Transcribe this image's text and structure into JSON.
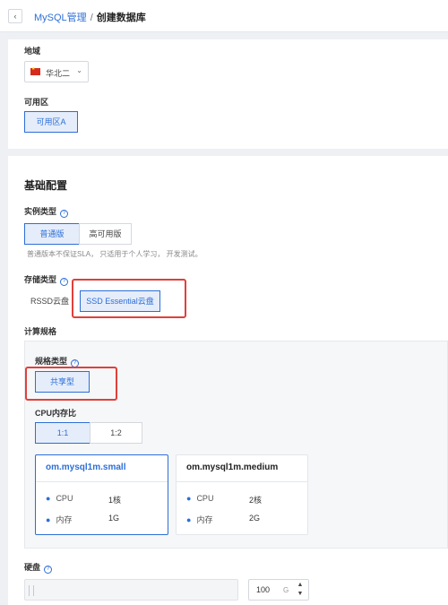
{
  "header": {
    "back_icon": "chevron-left-icon",
    "back_glyph": "‹",
    "breadcrumb_parent": "MySQL管理",
    "separator": "/",
    "breadcrumb_current": "创建数据库"
  },
  "location": {
    "region_label": "地域",
    "region_value": "华北二",
    "region_flag_icon": "china-flag-icon",
    "zone_label": "可用区",
    "zone_options": [
      "可用区A"
    ],
    "zone_selected": "可用区A"
  },
  "basic": {
    "title": "基础配置",
    "instance_type_label": "实例类型",
    "instance_types": [
      "普通版",
      "高可用版"
    ],
    "instance_selected": "普通版",
    "instance_hint": "普通版本不保证SLA， 只适用于个人学习， 开发测试。",
    "storage_type_label": "存储类型",
    "storage_types": [
      "RSSD云盘",
      "SSD Essential云盘"
    ],
    "storage_selected": "SSD Essential云盘",
    "compute_label": "计算规格",
    "spec_type_label": "规格类型",
    "spec_types": [
      "共享型"
    ],
    "spec_selected": "共享型",
    "ratio_label": "CPU内存比",
    "ratios": [
      "1:1",
      "1:2"
    ],
    "ratio_selected": "1:1",
    "specs": [
      {
        "name": "om.mysql1m.small",
        "cpu_label": "CPU",
        "cpu": "1核",
        "mem_label": "内存",
        "mem": "1G",
        "selected": true
      },
      {
        "name": "om.mysql1m.medium",
        "cpu_label": "CPU",
        "cpu": "2核",
        "mem_label": "内存",
        "mem": "2G",
        "selected": false
      }
    ],
    "disk_label": "硬盘",
    "disk_value": "100",
    "disk_unit": "G",
    "stepper_up": "▲",
    "stepper_down": "▼",
    "help_glyph": "?",
    "bullet": "●",
    "caret": "⌄"
  },
  "colors": {
    "accent": "#2d6fd6",
    "highlight_box": "#e0403a",
    "selected_bg": "#e5edfb"
  }
}
